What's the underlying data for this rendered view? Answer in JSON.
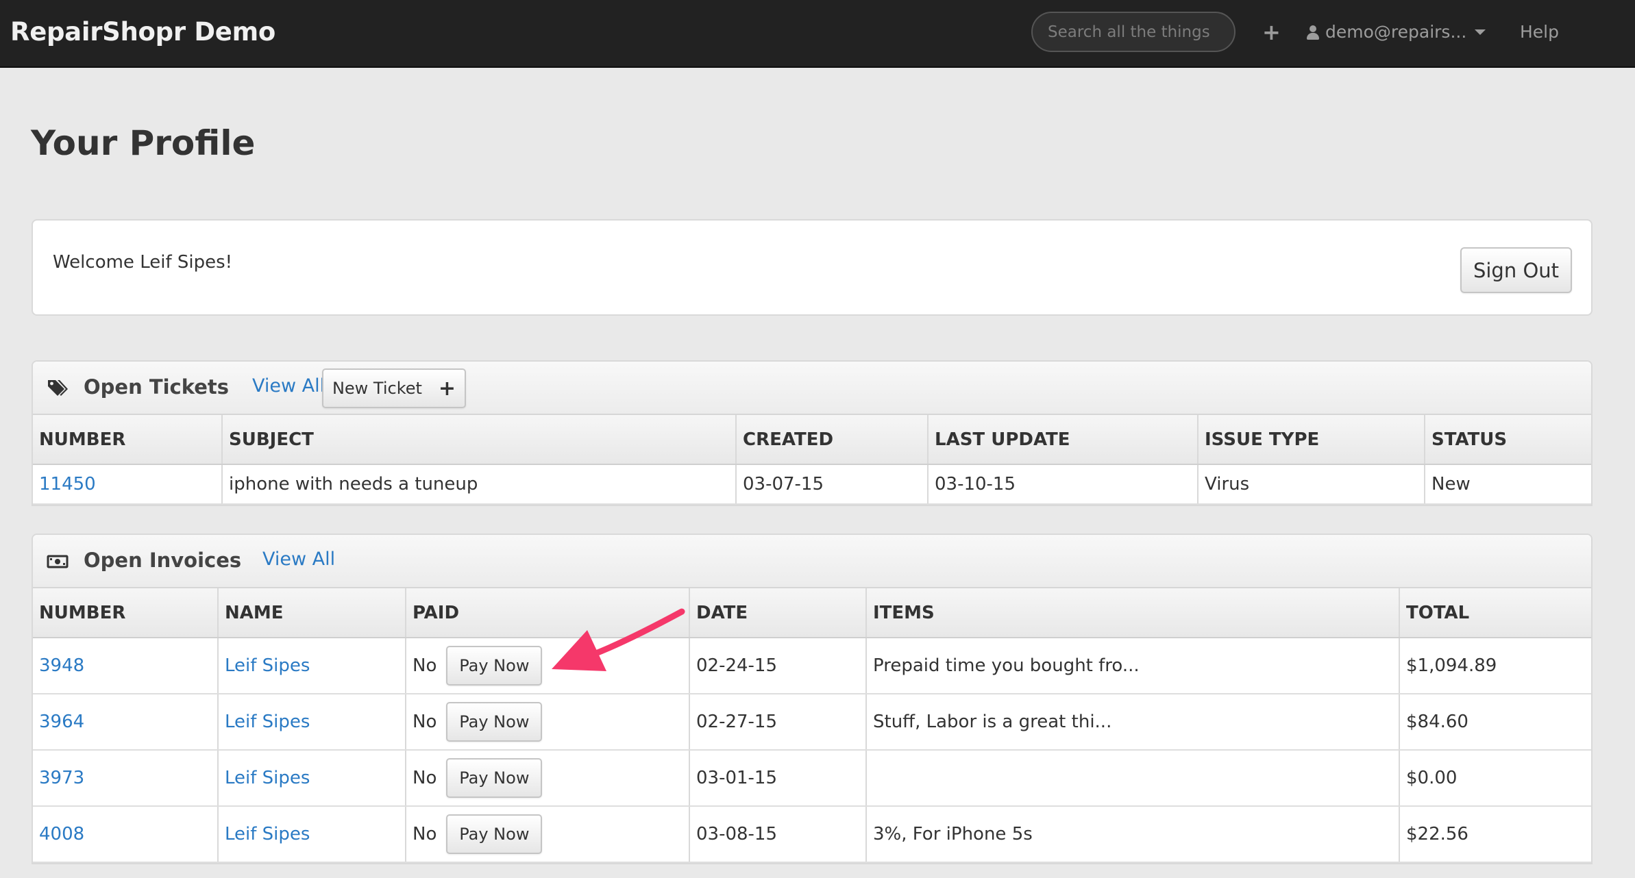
{
  "nav": {
    "brand": "RepairShopr Demo",
    "search_placeholder": "Search all the things",
    "plus_icon": "plus-icon",
    "user": "demo@repairs...",
    "help": "Help"
  },
  "page": {
    "title": "Your Profile"
  },
  "welcome": {
    "text": "Welcome Leif Sipes!",
    "sign_out": "Sign Out"
  },
  "tickets": {
    "icon": "tags-icon",
    "title": "Open Tickets",
    "view_all": "View All",
    "new_ticket": "New Ticket",
    "new_ticket_icon": "plus-icon",
    "columns": [
      "NUMBER",
      "SUBJECT",
      "CREATED",
      "LAST UPDATE",
      "ISSUE TYPE",
      "STATUS"
    ],
    "rows": [
      {
        "number": "11450",
        "subject": "iphone with needs a tuneup",
        "created": "03-07-15",
        "last_update": "03-10-15",
        "issue_type": "Virus",
        "status": "New"
      }
    ]
  },
  "invoices": {
    "icon": "money-icon",
    "title": "Open Invoices",
    "view_all": "View All",
    "columns": [
      "NUMBER",
      "NAME",
      "PAID",
      "DATE",
      "ITEMS",
      "TOTAL"
    ],
    "pay_now": "Pay Now",
    "rows": [
      {
        "number": "3948",
        "name": "Leif Sipes",
        "paid": "No",
        "date": "02-24-15",
        "items": "Prepaid time you bought fro...",
        "total": "$1,094.89"
      },
      {
        "number": "3964",
        "name": "Leif Sipes",
        "paid": "No",
        "date": "02-27-15",
        "items": "Stuff, Labor is a great thi...",
        "total": "$84.60"
      },
      {
        "number": "3973",
        "name": "Leif Sipes",
        "paid": "No",
        "date": "03-01-15",
        "items": "",
        "total": "$0.00"
      },
      {
        "number": "4008",
        "name": "Leif Sipes",
        "paid": "No",
        "date": "03-08-15",
        "items": "3%, For iPhone 5s",
        "total": "$22.56"
      }
    ]
  },
  "colors": {
    "navbar": "#222222",
    "link": "#2a7ac4",
    "arrow": "#f5386a",
    "background": "#e9e9e9"
  }
}
